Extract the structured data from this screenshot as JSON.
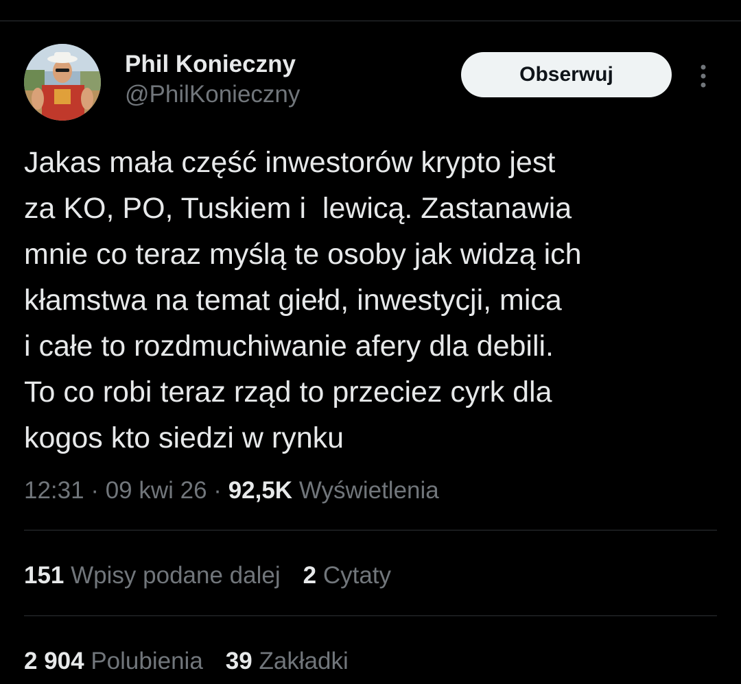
{
  "author": {
    "display_name": "Phil Konieczny",
    "handle": "@PhilKonieczny"
  },
  "follow_button": {
    "label": "Obserwuj"
  },
  "more_menu": {
    "icon": "more-vertical-icon"
  },
  "tweet": {
    "text": "Jakas mała część inwestorów krypto jest\nza KO, PO, Tuskiem i  lewicą. Zastanawia\nmnie co teraz myślą te osoby jak widzą ich\nkłamstwa na temat giełd, inwestycji, mica\ni całe to rozdmuchiwanie afery dla debili.\nTo co robi teraz rząd to przeciez cyrk dla\nkogos kto siedzi w rynku",
    "time": "12:31",
    "date": "09 kwi 26",
    "separator": " · ",
    "views_count": "92,5K",
    "views_label": "Wyświetlenia"
  },
  "stats": {
    "reposts": {
      "count": "151",
      "label": "Wpisy podane dalej"
    },
    "quotes": {
      "count": "2",
      "label": "Cytaty"
    },
    "likes": {
      "count": "2 904",
      "label": "Polubienia"
    },
    "bookmarks": {
      "count": "39",
      "label": "Zakładki"
    }
  },
  "colors": {
    "background": "#000000",
    "text_primary": "#e7e9ea",
    "text_secondary": "#71767b",
    "divider": "#2f3336",
    "follow_bg": "#eff3f4",
    "follow_text": "#0f1419"
  }
}
